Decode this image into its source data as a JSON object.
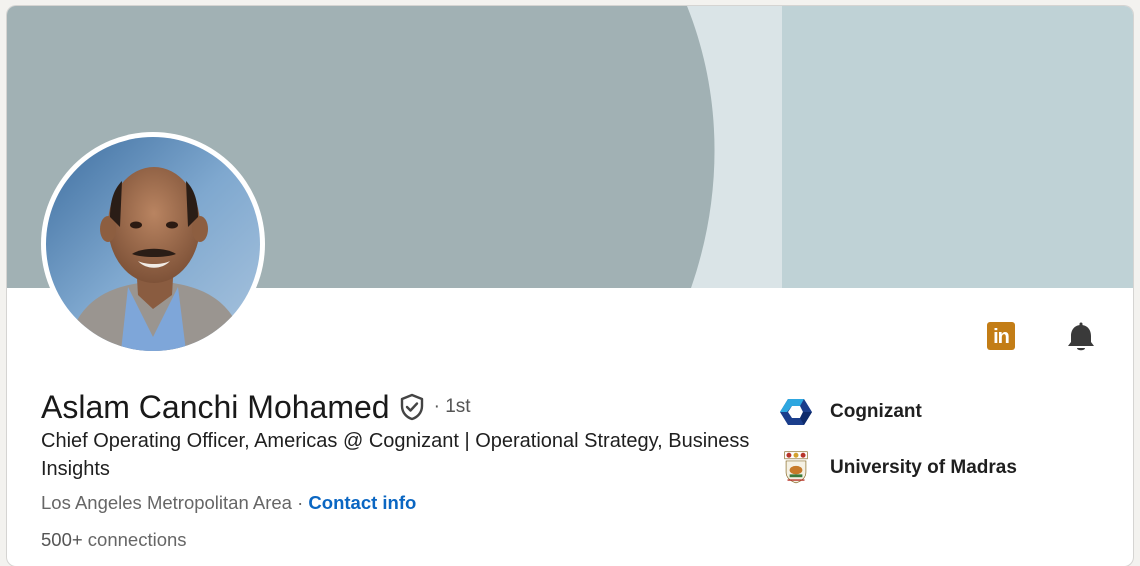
{
  "profile": {
    "name": "Aslam Canchi Mohamed",
    "degree": "· 1st",
    "headline": "Chief Operating Officer, Americas @ Cognizant | Operational Strategy, Business Insights",
    "location": "Los Angeles Metropolitan Area",
    "location_separator": " · ",
    "contact_label": "Contact info",
    "connections_count": "500+",
    "connections_label": " connections"
  },
  "actions": {
    "linkedin_label": "in"
  },
  "organizations": [
    {
      "name": "Cognizant",
      "logo": "cognizant-logo"
    },
    {
      "name": "University of Madras",
      "logo": "university-of-madras-seal"
    }
  ],
  "colors": {
    "banner_left": "#a1b1b4",
    "banner_mid": "#dae4e7",
    "banner_right": "#bfd2d6",
    "link": "#0a66c2",
    "linkedin_badge": "#c37d16"
  }
}
